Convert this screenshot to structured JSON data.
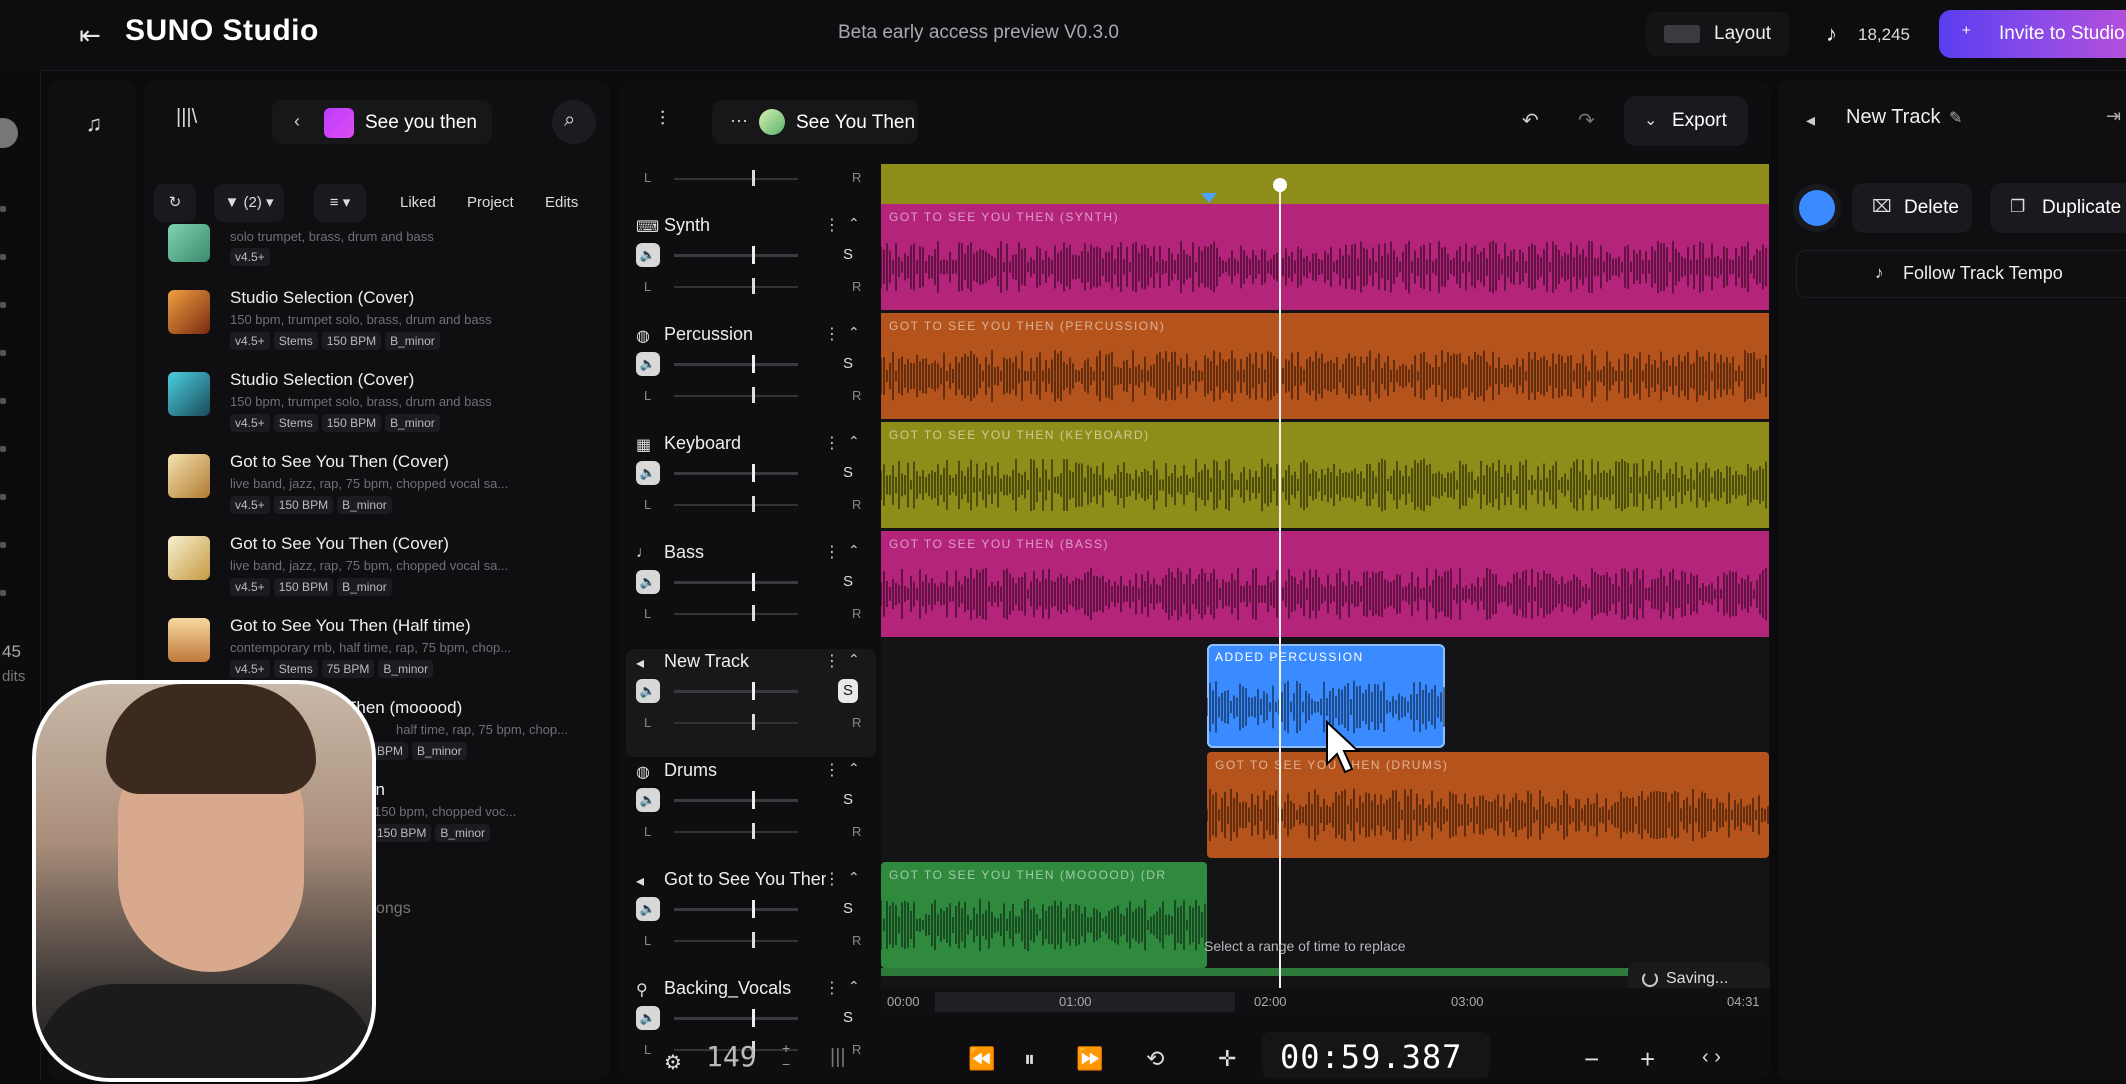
{
  "topbar": {
    "back_icon": "arrow-left-icon",
    "app_title": "SUNO Studio",
    "beta_text": "Beta early access preview V0.3.0",
    "layout_label": "Layout",
    "credits": "18,245",
    "invite_label": "Invite to Studio"
  },
  "rail": {
    "number": "45",
    "suffix": "dits"
  },
  "library": {
    "crumb_label": "See you then",
    "filter_count": "(2)",
    "filters": [
      "Liked",
      "Project",
      "Edits"
    ],
    "songs": [
      {
        "title": "",
        "desc": "solo trumpet, brass, drum and bass",
        "tags": [
          "v4.5+"
        ]
      },
      {
        "title": "Studio Selection (Cover)",
        "desc": "150 bpm, trumpet solo, brass, drum and bass",
        "tags": [
          "v4.5+",
          "Stems",
          "150 BPM",
          "B_minor"
        ]
      },
      {
        "title": "Studio Selection (Cover)",
        "desc": "150 bpm, trumpet solo, brass, drum and bass",
        "tags": [
          "v4.5+",
          "Stems",
          "150 BPM",
          "B_minor"
        ]
      },
      {
        "title": "Got to See You Then (Cover)",
        "desc": "live band, jazz, rap, 75 bpm, chopped vocal sa...",
        "tags": [
          "v4.5+",
          "150 BPM",
          "B_minor"
        ]
      },
      {
        "title": "Got to See You Then (Cover)",
        "desc": "live band, jazz, rap, 75 bpm, chopped vocal sa...",
        "tags": [
          "v4.5+",
          "150 BPM",
          "B_minor"
        ]
      },
      {
        "title": "Got to See You Then (Half time)",
        "desc": "contemporary rnb, half time, rap, 75 bpm, chop...",
        "tags": [
          "v4.5+",
          "Stems",
          "75 BPM",
          "B_minor"
        ]
      },
      {
        "title": "Then (mooood)",
        "desc": "half time, rap, 75 bpm, chop...",
        "tags": [
          "BPM",
          "B_minor"
        ]
      },
      {
        "title": "en",
        "desc": "150 bpm, chopped voc...",
        "tags": [
          "150 BPM",
          "B_minor"
        ]
      }
    ],
    "footer": "songs"
  },
  "mixer": {
    "crumb_label": "See You Then",
    "export_label": "Export",
    "tracks": [
      {
        "name": "Synth",
        "icon": "keyboard-icon"
      },
      {
        "name": "Percussion",
        "icon": "drum-icon"
      },
      {
        "name": "Keyboard",
        "icon": "piano-icon"
      },
      {
        "name": "Bass",
        "icon": "guitar-icon"
      },
      {
        "name": "New Track",
        "icon": "waveform-icon"
      },
      {
        "name": "Drums",
        "icon": "drum-icon"
      },
      {
        "name": "Got to See You Then",
        "icon": "waveform-icon"
      },
      {
        "name": "Backing_Vocals",
        "icon": "mic-icon"
      }
    ],
    "clips": [
      {
        "label": "GOT TO SEE YOU THEN (SYNTH)",
        "color": "#b3247a"
      },
      {
        "label": "GOT TO SEE YOU THEN (PERCUSSION)",
        "color": "#b4531b"
      },
      {
        "label": "GOT TO SEE YOU THEN (KEYBOARD)",
        "color": "#8f8d19"
      },
      {
        "label": "GOT TO SEE YOU THEN (BASS)",
        "color": "#b3247a"
      },
      {
        "label": "ADDED PERCUSSION",
        "color": "#3a8bff"
      },
      {
        "label": "GOT TO SEE YOU THEN (DRUMS)",
        "color": "#b4531b"
      },
      {
        "label": "GOT TO SEE YOU THEN (MOOOOD) (DR",
        "color": "#2f8a3e"
      }
    ],
    "replace_hint": "Select a range of time to replace",
    "saving_label": "Saving...",
    "ruler": [
      "00:00",
      "01:00",
      "02:00",
      "03:00",
      "04:31"
    ],
    "bpm": "149",
    "time": "00:59.387",
    "pan_left": "L",
    "pan_right": "R",
    "solo_label": "S"
  },
  "right_panel": {
    "title": "New Track",
    "delete_label": "Delete",
    "duplicate_label": "Duplicate",
    "tempo_label": "Follow Track Tempo"
  }
}
